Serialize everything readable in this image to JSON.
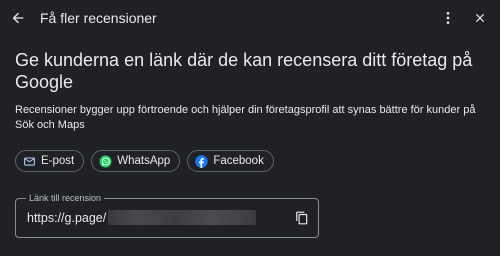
{
  "header": {
    "title": "Få fler recensioner",
    "back_icon": "arrow-back-icon",
    "more_icon": "more-vert-icon",
    "close_icon": "close-icon"
  },
  "main": {
    "headline": "Ge kunderna en länk där de kan recensera ditt företag på Google",
    "description": "Recensioner bygger upp förtroende och hjälper din företagsprofil att synas bättre för kunder på Sök och Maps",
    "share_chips": [
      {
        "label": "E-post",
        "icon": "mail-icon"
      },
      {
        "label": "WhatsApp",
        "icon": "whatsapp-icon",
        "color": "#25d366"
      },
      {
        "label": "Facebook",
        "icon": "facebook-icon",
        "color": "#1877f2"
      }
    ],
    "link_field": {
      "label": "Länk till recension",
      "value": "https://g.page/",
      "copy_icon": "copy-icon"
    }
  },
  "colors": {
    "background": "#202124",
    "text": "#e8eaed",
    "border": "#5f6368"
  }
}
